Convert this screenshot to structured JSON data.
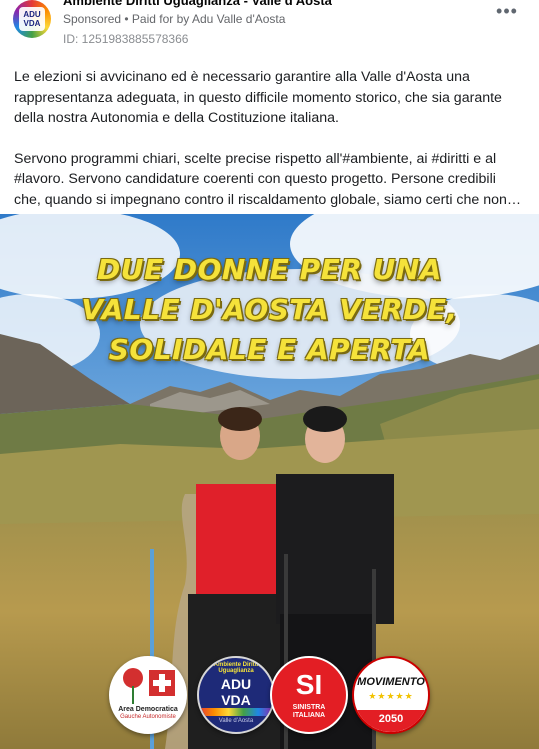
{
  "post": {
    "page_name": "Ambiente Diritti Uguaglianza - Valle d'Aosta",
    "sponsored": "Sponsored",
    "separator": " • ",
    "paid_for_by": "Paid for by",
    "payer": "Adu Valle d'Aosta",
    "ad_id": "ID: 1251983885578366",
    "more_icon": "more-horizontal-icon",
    "avatar_text_line1": "ADU",
    "avatar_text_line2": "VDA",
    "paragraphs": [
      "Le elezioni si avvicinano ed è necessario garantire alla Valle d'Aosta una rappresentanza adeguata, in questo difficile momento storico, che sia garante della nostra Autonomia e della Costituzione italiana.",
      "Servono programmi chiari, scelte precise rispetto all'#ambiente, ai #diritti e al #lavoro. Servono candidature coerenti con questo progetto. Persone credibili che, quando si impegnano contro il riscaldamento globale, siamo certi che non…"
    ]
  },
  "image": {
    "headline_lines": [
      "DUE DONNE PER UNA",
      "VALLE D'AOSTA VERDE,",
      "SOLIDALE E APERTA"
    ],
    "headline_color": "#f5e23a",
    "logos": {
      "area_democratica_line1": "Area Democratica",
      "area_democratica_line2": "Gauche Autonomiste",
      "adu_arc": "Ambiente Diritti Uguaglianza",
      "adu_big_line1": "ADU",
      "adu_big_line2": "VDA",
      "adu_place": "Valle d'Aosta",
      "si_mark": "SI",
      "si_name_line1": "SINISTRA",
      "si_name_line2": "ITALIANA",
      "m5s_word": "MOVIMENTO",
      "m5s_stars": "★★★★★",
      "m5s_year": "2050"
    }
  }
}
